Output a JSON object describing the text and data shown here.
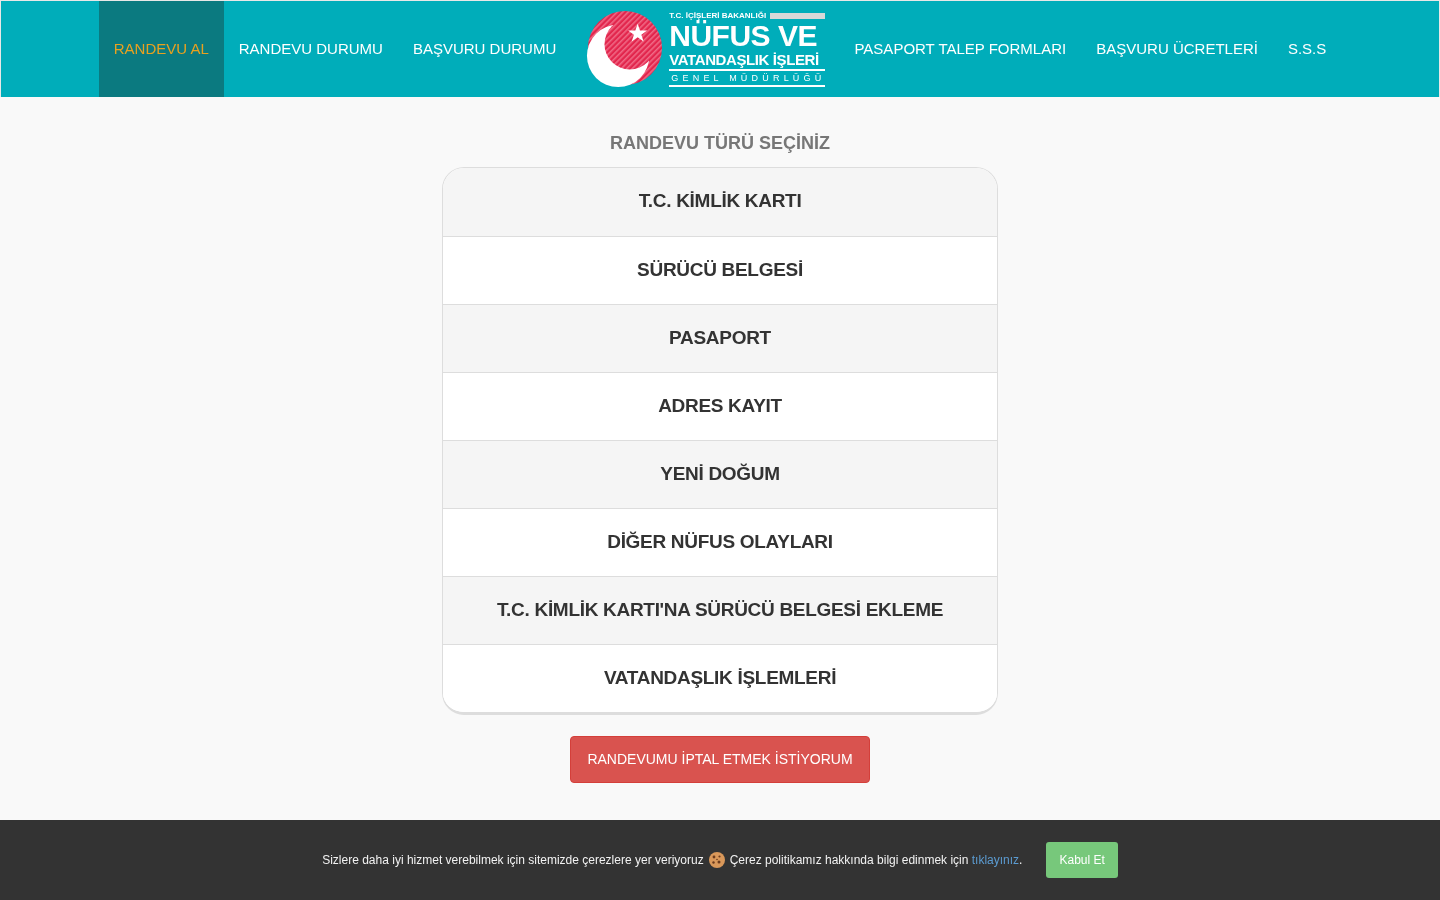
{
  "navbar": {
    "items_left": [
      {
        "label": "RANDEVU AL",
        "selected": true
      },
      {
        "label": "RANDEVU DURUMU",
        "selected": false
      },
      {
        "label": "BAŞVURU DURUMU",
        "selected": false
      }
    ],
    "logo": {
      "ministry": "T.C. İÇİŞLERİ BAKANLIĞI",
      "title": "NÜFUS VE",
      "subtitle": "VATANDAŞLIK İŞLERİ",
      "directorate": "GENEL MÜDÜRLÜĞÜ"
    },
    "items_right": [
      {
        "label": "PASAPORT TALEP FORMLARI",
        "selected": false
      },
      {
        "label": "BAŞVURU ÜCRETLERİ",
        "selected": false
      },
      {
        "label": "S.S.S",
        "selected": false
      }
    ]
  },
  "heading": "RANDEVU TÜRÜ SEÇİNİZ",
  "appointment_types": [
    "T.C. KİMLİK KARTI",
    "SÜRÜCÜ BELGESİ",
    "PASAPORT",
    "ADRES KAYIT",
    "YENİ DOĞUM",
    "DİĞER NÜFUS OLAYLARI",
    "T.C. KİMLİK KARTI'NA SÜRÜCÜ BELGESİ EKLEME",
    "VATANDAŞLIK İŞLEMLERİ"
  ],
  "cancel_button": "RANDEVUMU İPTAL ETMEK İSTİYORUM",
  "cookie_notice": {
    "text": "Sizlere daha iyi hizmet verebilmek için sitemizde çerezlere yer veriyoruz",
    "policy_text": "Çerez politikamız hakkında bilgi edinmek için",
    "link": "tıklayınız",
    "link_suffix": ".",
    "accept_button": "Kabul Et"
  }
}
